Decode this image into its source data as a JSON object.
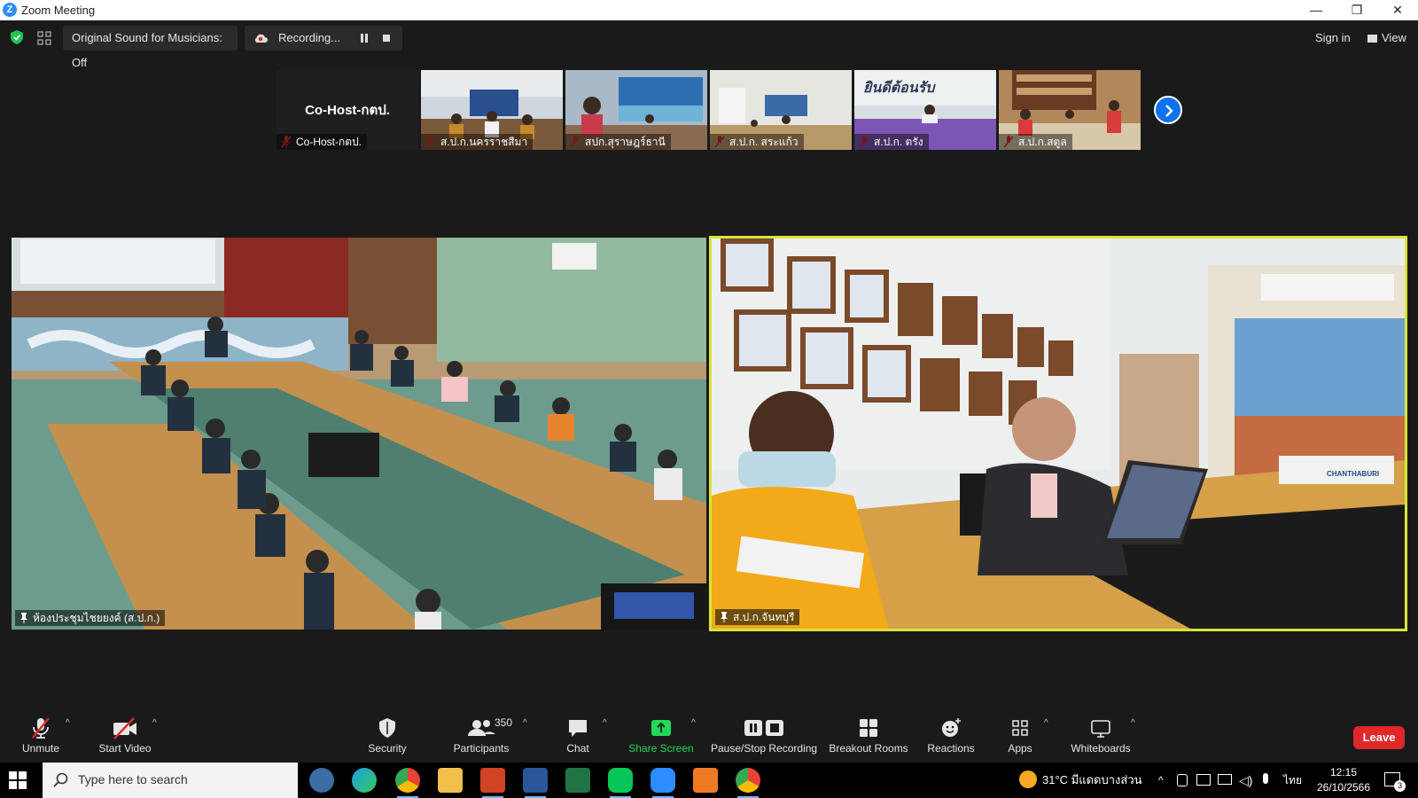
{
  "window": {
    "title": "Zoom Meeting",
    "min": "—",
    "max": "❐",
    "close": "✕"
  },
  "topbar": {
    "original_sound": "Original Sound for Musicians: Off",
    "recording": "Recording...",
    "sign_in": "Sign in",
    "view": "View"
  },
  "thumbnails": [
    {
      "name": "Co-Host-กตป.",
      "big": "Co-Host-กตป."
    },
    {
      "name": "ส.ป.ก.นครราชสีมา"
    },
    {
      "name": "สปก.สุราษฎร์ธานี"
    },
    {
      "name": "ส.ป.ก. สระแก้ว"
    },
    {
      "name": "ส.ป.ก. ตรัง",
      "banner": "ยินดีต้อนรับ"
    },
    {
      "name": "ส.ป.ก.สตูล"
    }
  ],
  "videos": [
    {
      "name": "ห้องประชุมไชยยงค์ (ส.ป.ก.)"
    },
    {
      "name": "ส.ป.ก.จันทบุรี",
      "sign": "CHANTHABURI"
    }
  ],
  "toolbar": {
    "unmute": "Unmute",
    "start_video": "Start Video",
    "security": "Security",
    "participants": "Participants",
    "participants_count": "350",
    "chat": "Chat",
    "share_screen": "Share Screen",
    "pause_stop": "Pause/Stop Recording",
    "breakout": "Breakout Rooms",
    "reactions": "Reactions",
    "apps": "Apps",
    "whiteboards": "Whiteboards",
    "leave": "Leave"
  },
  "taskbar": {
    "search_placeholder": "Type here to search",
    "weather": "31°C มีแดดบางส่วน",
    "lang": "ไทย",
    "time": "12:15",
    "date": "26/10/2566",
    "notif_count": "3"
  },
  "colors": {
    "accent": "#0e72ed",
    "leave": "#e02828",
    "share": "#23d959",
    "active_border": "#d7e53b"
  }
}
